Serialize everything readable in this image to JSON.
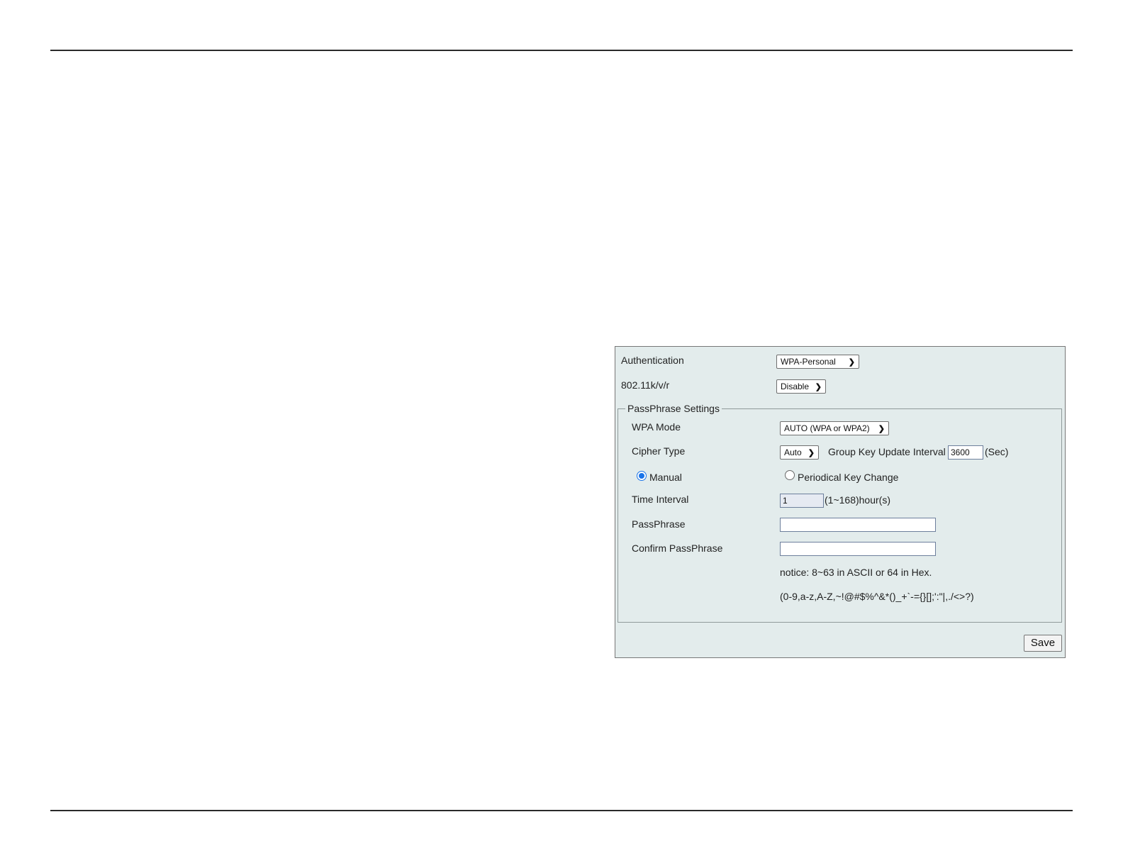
{
  "wireless_security": {
    "authentication": {
      "label": "Authentication",
      "value": "WPA-Personal"
    },
    "roaming": {
      "label": "802.11k/v/r",
      "value": "Disable"
    },
    "passphrase_settings": {
      "legend": "PassPhrase Settings",
      "wpa_mode": {
        "label": "WPA Mode",
        "value": "AUTO (WPA or WPA2)"
      },
      "cipher_type": {
        "label": "Cipher Type",
        "value": "Auto"
      },
      "group_key": {
        "label": "Group Key Update Interval",
        "value": "3600",
        "unit": "(Sec)"
      },
      "key_mode": {
        "manual_label": "Manual",
        "periodical_label": "Periodical Key Change",
        "selected": "Manual"
      },
      "time_interval": {
        "label": "Time Interval",
        "value": "1",
        "range": "(1~168)hour(s)"
      },
      "passphrase": {
        "label": "PassPhrase",
        "value": ""
      },
      "confirm_passphrase": {
        "label": "Confirm PassPhrase",
        "value": ""
      },
      "notice": "notice: 8~63 in ASCII or 64 in Hex.",
      "allowed_chars": "(0-9,a-z,A-Z,~!@#$%^&*()_+`-={}[];':\"|,./<>?)"
    },
    "save_label": "Save"
  },
  "colors": {
    "panel_background": "#e3ecec",
    "radio_accent": "#1a73e8",
    "rule": "#2a2a2a"
  }
}
